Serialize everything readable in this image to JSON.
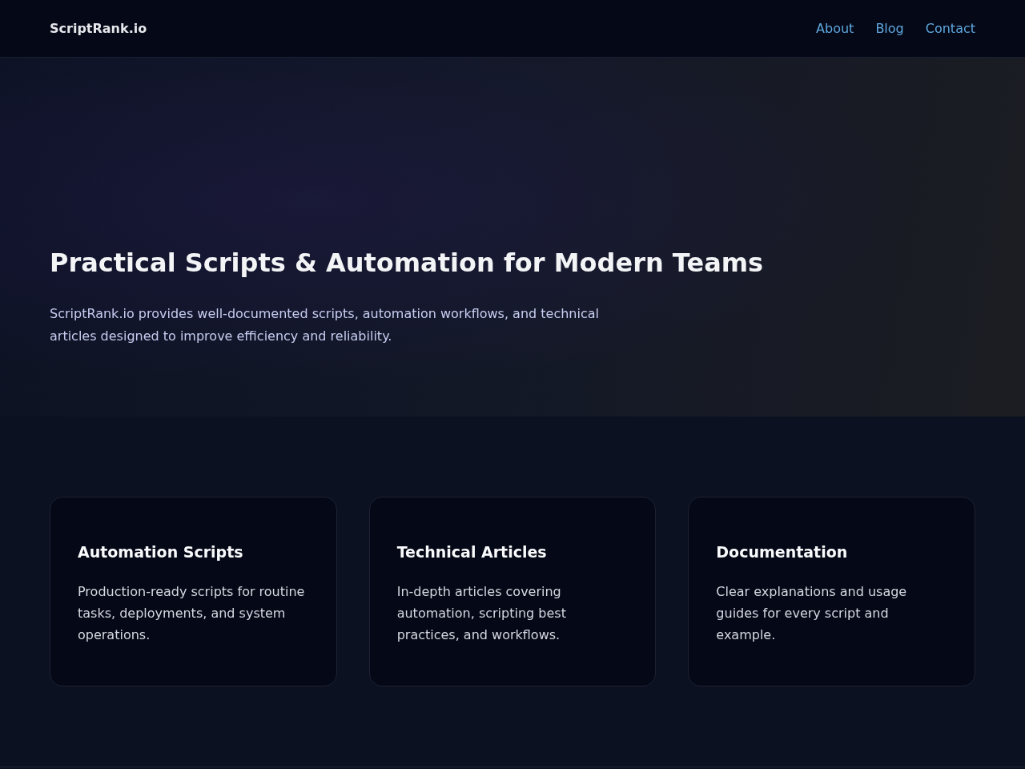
{
  "header": {
    "logo": "ScriptRank.io",
    "nav": [
      "About",
      "Blog",
      "Contact"
    ]
  },
  "hero": {
    "title": "Practical Scripts & Automation for Modern Teams",
    "text": "ScriptRank.io provides well-documented scripts, automation workflows, and technical articles designed to improve efficiency and reliability."
  },
  "features": [
    {
      "title": "Automation Scripts",
      "text": "Production-ready scripts for routine tasks, deployments, and system operations."
    },
    {
      "title": "Technical Articles",
      "text": "In-depth articles covering automation, scripting best practices, and workflows."
    },
    {
      "title": "Documentation",
      "text": "Clear explanations and usage guides for every script and example."
    }
  ]
}
